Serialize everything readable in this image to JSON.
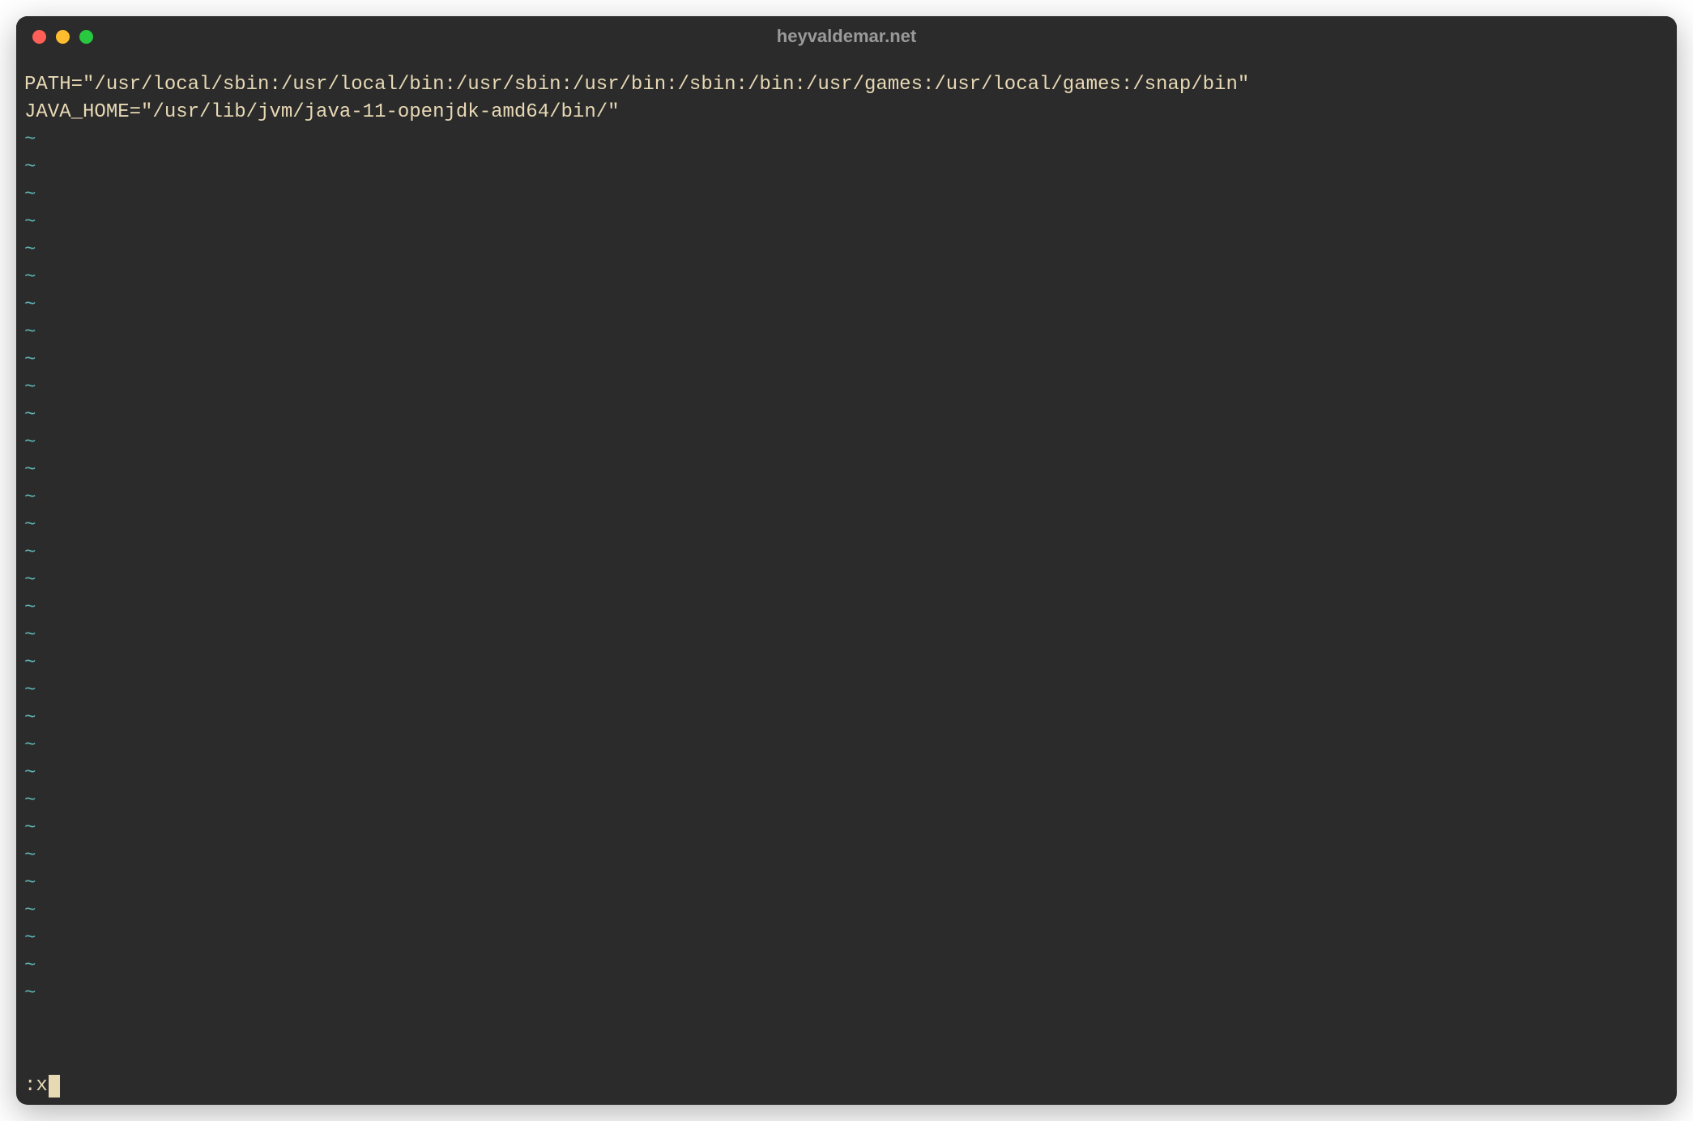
{
  "window": {
    "title": "heyvaldemar.net"
  },
  "editor": {
    "lines": [
      "PATH=\"/usr/local/sbin:/usr/local/bin:/usr/sbin:/usr/bin:/sbin:/bin:/usr/games:/usr/local/games:/snap/bin\"",
      "JAVA_HOME=\"/usr/lib/jvm/java-11-openjdk-amd64/bin/\""
    ],
    "tilde_char": "~",
    "tilde_count": 32
  },
  "command": {
    "prefix": ":",
    "text": "x"
  }
}
